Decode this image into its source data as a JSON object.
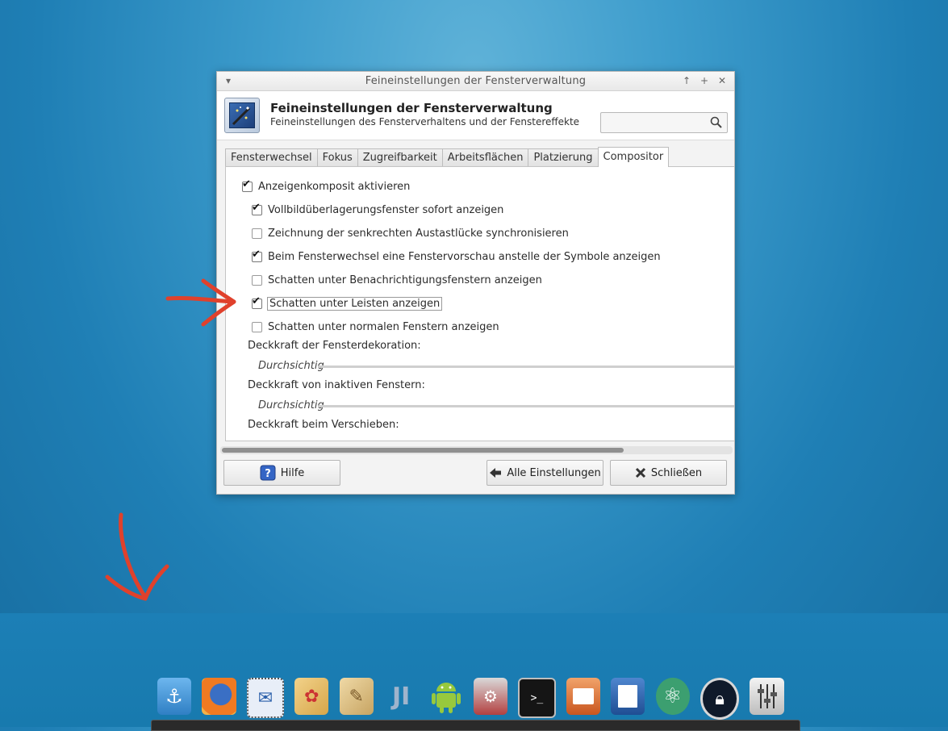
{
  "window": {
    "title": "Feineinstellungen der Fensterverwaltung",
    "header_title": "Feineinstellungen der Fensterverwaltung",
    "header_subtitle": "Feineinstellungen des Fensterverhaltens und der Fenstereffekte",
    "search_placeholder": ""
  },
  "tabs": [
    {
      "label": "Fensterwechsel"
    },
    {
      "label": "Fokus"
    },
    {
      "label": "Zugreifbarkeit"
    },
    {
      "label": "Arbeitsflächen"
    },
    {
      "label": "Platzierung"
    },
    {
      "label": "Compositor",
      "active": true
    }
  ],
  "options": [
    {
      "label": "Anzeigenkomposit aktivieren",
      "checked": true
    },
    {
      "label": "Vollbildüberlagerungsfenster sofort anzeigen",
      "checked": true
    },
    {
      "label": "Zeichnung der senkrechten Austastlücke synchronisieren",
      "checked": false
    },
    {
      "label": "Beim Fensterwechsel eine Fenstervorschau anstelle der Symbole anzeigen",
      "checked": true
    },
    {
      "label": "Schatten unter Benachrichtigungsfenstern anzeigen",
      "checked": false
    },
    {
      "label": "Schatten unter Leisten anzeigen",
      "checked": true
    },
    {
      "label": "Schatten unter normalen Fenstern anzeigen",
      "checked": false
    }
  ],
  "opacity": {
    "decoration_label": "Deckkraft der Fensterdekoration:",
    "inactive_label": "Deckkraft von inaktiven Fenstern:",
    "move_label": "Deckkraft beim Verschieben:",
    "slider_min_label": "Durchsichtig"
  },
  "buttons": {
    "help": "Hilfe",
    "all_settings": "Alle Einstellungen",
    "close": "Schließen"
  },
  "dock": [
    {
      "name": "anchor-icon",
      "color": "#3b8ed3"
    },
    {
      "name": "firefox-icon",
      "color": "#e8772a"
    },
    {
      "name": "stamp-icon",
      "color": "#6e8fc7"
    },
    {
      "name": "paint-palette-icon",
      "color": "#d7b262"
    },
    {
      "name": "scroll-quill-icon",
      "color": "#c9a968"
    },
    {
      "name": "jetbrains-icon",
      "color": "#5a7fa8"
    },
    {
      "name": "android-icon",
      "color": "#8cc43f"
    },
    {
      "name": "network-device-icon",
      "color": "#c23b3b"
    },
    {
      "name": "terminal-icon",
      "color": "#1c1c1c"
    },
    {
      "name": "presentation-icon",
      "color": "#d86d2a"
    },
    {
      "name": "document-writer-icon",
      "color": "#2c5aa0"
    },
    {
      "name": "atom-icon",
      "color": "#3f9a6a"
    },
    {
      "name": "keepass-lock-icon",
      "color": "#1f2a3a"
    },
    {
      "name": "mixer-settings-icon",
      "color": "#8d8d8d"
    }
  ]
}
